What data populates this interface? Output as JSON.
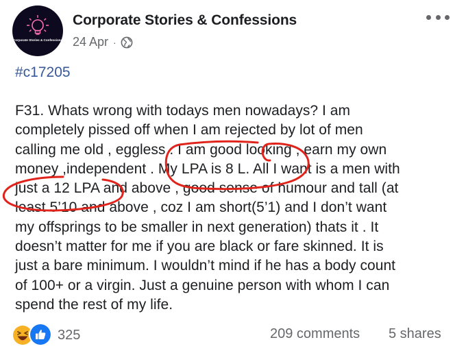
{
  "page": {
    "name": "Corporate Stories & Confessions",
    "avatar_caption": "Corporate Stories & Confessions",
    "date": "24 Apr",
    "separator": "·"
  },
  "post": {
    "hashtag": "#c17205",
    "lines": [
      "F31. Whats wrong with todays men nowadays? I am",
      "completely pissed off when I am rejected by lot of men",
      "calling me old , eggless . I am good looking , earn my own",
      "money ,independent . My LPA is 8 L. All I want is a men with",
      "just a 12 LPA and above , good sense of humour and tall (at",
      "least 5’10 and above , coz I am short(5’1) and I don’t want",
      "my offsprings to be smaller  in next generation) thats it . It",
      "doesn’t matter for me if you are black or fare skinned. It is",
      "just a bare minimum. I wouldn’t mind if he has a body count",
      "of 100+ or a virgin. Just a genuine person with whom I can",
      "spend the rest of my life."
    ]
  },
  "footer": {
    "reaction_count": "325",
    "comments": "209 comments",
    "shares": "5 shares"
  },
  "icons": {
    "avatar": "lightbulb-logo",
    "privacy": "globe-icon",
    "menu": "more-icon",
    "reaction_1": "haha-icon",
    "reaction_2": "like-icon"
  },
  "colors": {
    "link": "#385898",
    "secondary_text": "#65676b",
    "annotation": "#e0241b",
    "like": "#1877f2",
    "haha": "#f7b125"
  }
}
